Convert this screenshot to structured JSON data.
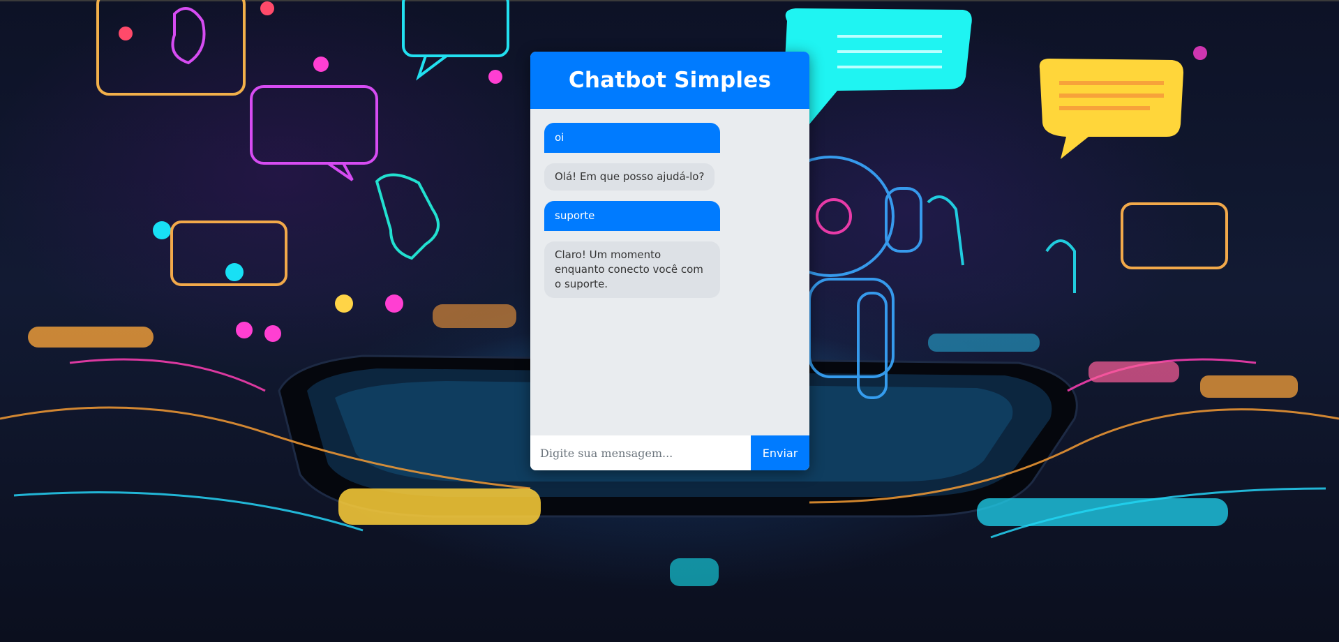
{
  "chat": {
    "title": "Chatbot Simples",
    "messages": [
      {
        "sender": "user",
        "text": "oi"
      },
      {
        "sender": "bot",
        "text": "Olá! Em que posso ajudá-lo?"
      },
      {
        "sender": "user",
        "text": "suporte"
      },
      {
        "sender": "bot",
        "text": "Claro! Um momento enquanto conecto você com o suporte."
      }
    ],
    "input": {
      "placeholder": "Digite sua mensagem...",
      "value": ""
    },
    "send_label": "Enviar"
  },
  "colors": {
    "accent": "#007bff",
    "chat_background": "#e9ecef",
    "bot_bubble": "#dde1e6",
    "page_background": "#0d1226"
  },
  "background": {
    "description_icon": "robot-phone-illustration"
  }
}
